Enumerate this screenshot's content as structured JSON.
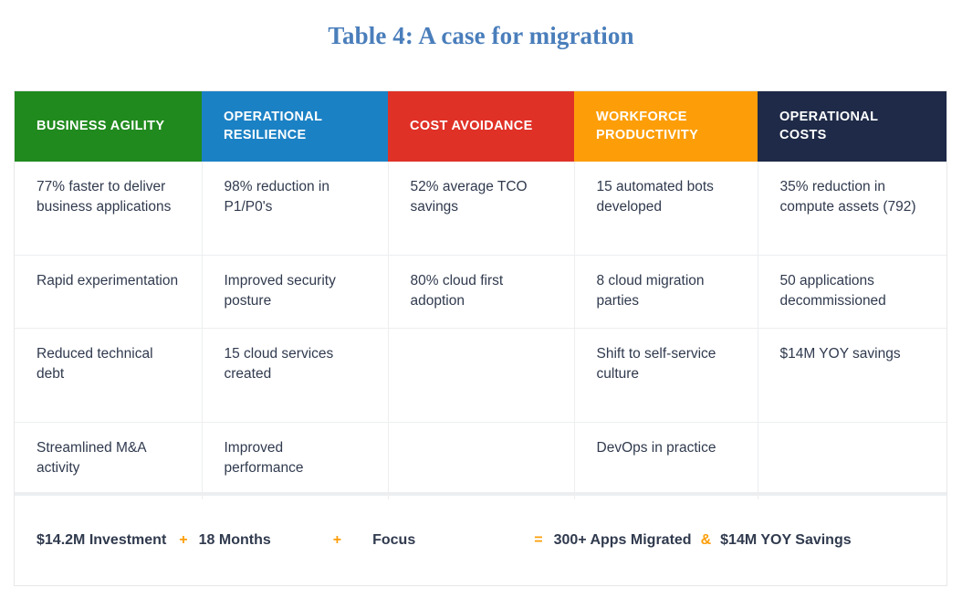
{
  "title": "Table 4: A case for migration",
  "colors": {
    "title": "#4a7ebb",
    "business_agility": "#208a1e",
    "operational_resilience": "#1b81c5",
    "cost_avoidance": "#e03127",
    "workforce_productivity": "#fd9e09",
    "operational_costs": "#1e2a47",
    "accent_operator": "#fd9e09",
    "body_text": "#303a4e"
  },
  "table": {
    "headers": [
      "BUSINESS AGILITY",
      "OPERATIONAL RESILIENCE",
      "COST AVOIDANCE",
      "WORKFORCE PRODUCTIVITY",
      "OPERATIONAL COSTS"
    ],
    "rows": [
      [
        "77% faster to deliver business applications",
        "98% reduction in P1/P0's",
        "52% average TCO savings",
        "15 automated bots developed",
        "35% reduction in compute assets (792)"
      ],
      [
        "Rapid experimentation",
        "Improved security posture",
        "80% cloud first adoption",
        "8 cloud migration parties",
        "50 applications decommissioned"
      ],
      [
        "Reduced technical debt",
        "15 cloud services created",
        "",
        "Shift to self-service culture",
        "$14M YOY savings"
      ],
      [
        "Streamlined M&A activity",
        "Improved performance",
        "",
        "DevOps in practice",
        ""
      ]
    ],
    "summary": {
      "term1": "$14.2M Investment",
      "op1": "+",
      "term2": "18 Months",
      "op2": "+",
      "term3": "Focus",
      "op3": "=",
      "term4": "300+ Apps Migrated",
      "op4": "&",
      "term5": "$14M YOY Savings"
    }
  }
}
